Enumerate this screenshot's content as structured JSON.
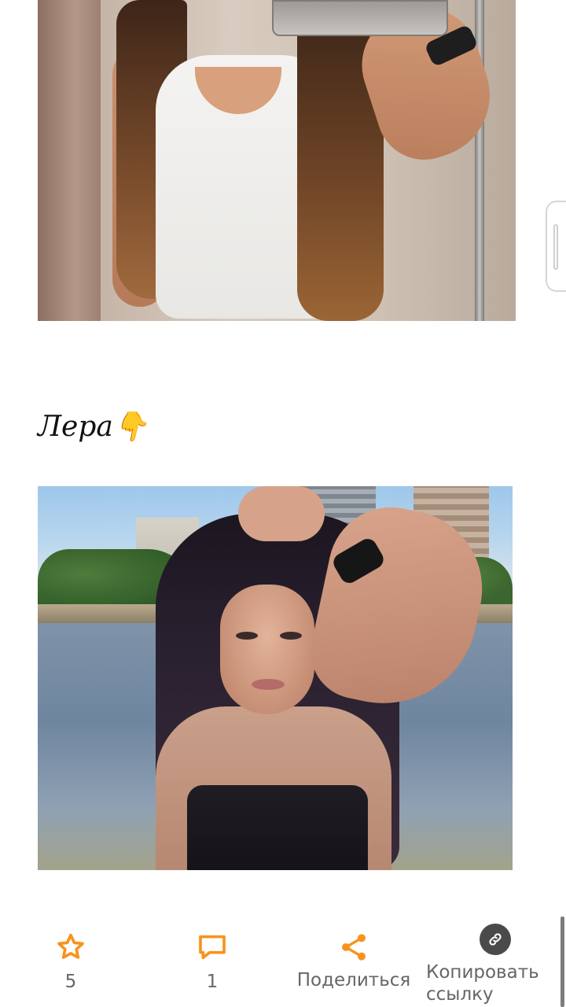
{
  "post": {
    "caption": "Лера👇"
  },
  "actions": {
    "rating_count": "5",
    "comments_count": "1",
    "share_label": "Поделиться",
    "copy_label_line1": "Копировать",
    "copy_label_line2": "ссылку"
  },
  "icons": {
    "rating": "star-icon",
    "comments": "comment-icon",
    "share": "share-icon",
    "copy": "link-icon"
  },
  "colors": {
    "accent": "#f7931e",
    "label": "#666666",
    "link_circle": "#4a4a4a"
  }
}
